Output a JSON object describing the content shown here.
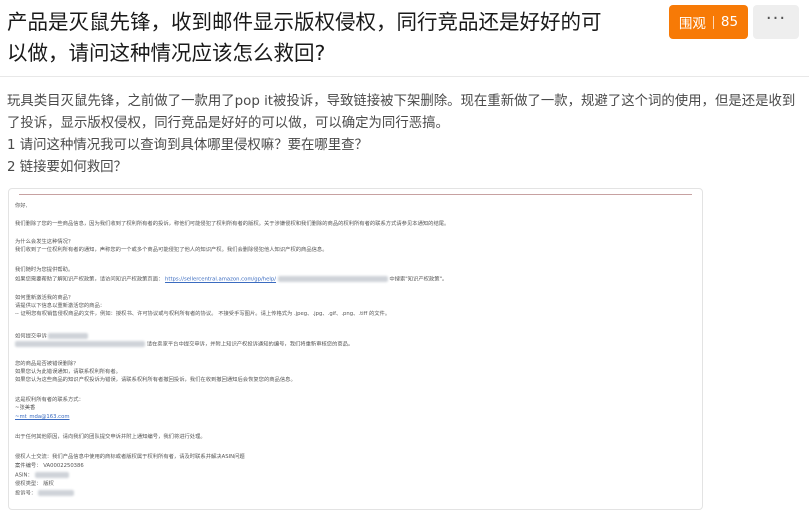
{
  "question": {
    "title": "产品是灭鼠先锋，收到邮件显示版权侵权，同行竞品还是好好的可以做，请问这种情况应该怎么救回?"
  },
  "actions": {
    "view_label": "围观",
    "view_count": "85",
    "more_label": "···"
  },
  "content": {
    "paragraphs": [
      "玩具类目灭鼠先锋，之前做了一款用了pop it被投诉，导致链接被下架删除。现在重新做了一款，规避了这个词的使用，但是还是收到了投诉，显示版权侵权，同行竞品是好好的可以做，可以确定为同行恶搞。",
      "1 请问这种情况我可以查询到具体哪里侵权嘛？要在哪里查？",
      "2 链接要如何救回？"
    ]
  },
  "email": {
    "greeting": "你好,",
    "p1": "我们删除了您的一些商品信息，因为我们收到了权利所有者的投诉，称他们可能侵犯了权利所有者的版权。关于涉嫌侵权和我们删除的商品的权利所有者的联系方式请参见本通知的结尾。",
    "h_why": "为什么会发生这种情况？",
    "why_body": "我们收到了一位权利所有者的通知，声称您的一个或多个商品可能侵犯了他人的知识产权。我们会删除侵犯他人知识产权的商品信息。",
    "h_help": "我们随时为您提供帮助。",
    "help_body_pre": "如果您需要帮助了解知识产权政策，请访问知识产权政策页面：",
    "help_link": "https://sellercentral.amazon.com/gp/help/",
    "help_body_post": "中搜索\"知识产权政策\"。",
    "h_reinstate": "如何重新激活我的商品？",
    "reinstate_intro": "请提供以下信息以重新激活您的商品：",
    "reinstate_item": "-- 证明您有权销售侵权商品的文件，例如：授权书、许可协议或与权利所有者的协议。",
    "reinstate_formats": "不接受手写图片。请上传格式为 .jpeg、.jpg、.gif、.png、.tiff 的文件。",
    "appeal_line1": "如何提交申诉",
    "appeal_line2": "请在卖家平台中提交申诉，并附上知识产权投诉通知的编号，我们将重新审核您的商品。",
    "h_notice": "您的商品是否被错误删除？",
    "notice_1": "如果您认为此错误通知，请联系权利所有者。",
    "notice_2": "如果您认为这些商品的知识产权投诉为错误，请联系权利所有者撤回投诉，我们在收到撤回通知后会恢复您的商品信息。",
    "h_contact": "这是权利所有者的联系方式：",
    "contact_name": "~张美香",
    "contact_email": "~mt_mda@163.com",
    "closing": "出于任何其他原因，请向我们的团队提交申诉并附上通知编号，我们将进行处理。",
    "footer_intro": "侵权人士交流：我们产品信息中使用的商标或者版权属于权利所有者，请及时联系并解决ASIN问题",
    "case_label": "案件编号：",
    "case_value": "VA0002250386",
    "asin_label": "ASIN：",
    "type_label": "侵权类型：",
    "type_value": "版权",
    "complaint_label": "投诉号："
  }
}
